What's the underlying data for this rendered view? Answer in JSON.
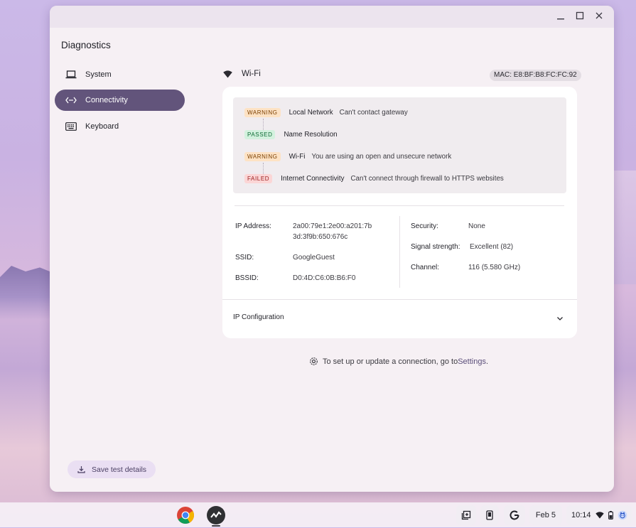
{
  "window": {
    "app_title": "Diagnostics",
    "controls": [
      "minimize-icon",
      "maximize-icon",
      "close-icon"
    ]
  },
  "sidebar": {
    "items": [
      {
        "label": "System",
        "icon": "laptop-icon",
        "active": false
      },
      {
        "label": "Connectivity",
        "icon": "connectivity-icon",
        "active": true
      },
      {
        "label": "Keyboard",
        "icon": "keyboard-icon",
        "active": false
      }
    ],
    "save_button": "Save test details"
  },
  "network": {
    "name": "Wi-Fi",
    "mac": "MAC: E8:BF:B8:FC:FC:92",
    "routines": [
      {
        "status": "WARNING",
        "name": "Local Network",
        "message": "Can't contact gateway"
      },
      {
        "status": "PASSED",
        "name": "Name Resolution",
        "message": ""
      },
      {
        "status": "WARNING",
        "name": "Wi-Fi",
        "message": "You are using an open and unsecure network"
      },
      {
        "status": "FAILED",
        "name": "Internet Connectivity",
        "message": "Can't connect through firewall to HTTPS websites"
      }
    ],
    "info_left": [
      {
        "label": "IP Address:",
        "value": "2a00:79e1:2e00:a201:7b",
        "value2": "3d:3f9b:650:676c"
      },
      {
        "label": "SSID:",
        "value": "GoogleGuest"
      },
      {
        "label": "BSSID:",
        "value": "D0:4D:C6:0B:B6:F0"
      }
    ],
    "info_right": [
      {
        "label": "Security:",
        "value": "None"
      },
      {
        "label": "Signal strength:",
        "value": "Excellent (82)"
      },
      {
        "label": "Channel:",
        "value": "116 (5.580 GHz)"
      }
    ],
    "ip_config": "IP Configuration"
  },
  "footer_note": {
    "text": "To set up or update a connection, go to ",
    "link": "Settings",
    "end": "."
  },
  "shelf": {
    "date": "Feb 5",
    "time": "10:14"
  }
}
